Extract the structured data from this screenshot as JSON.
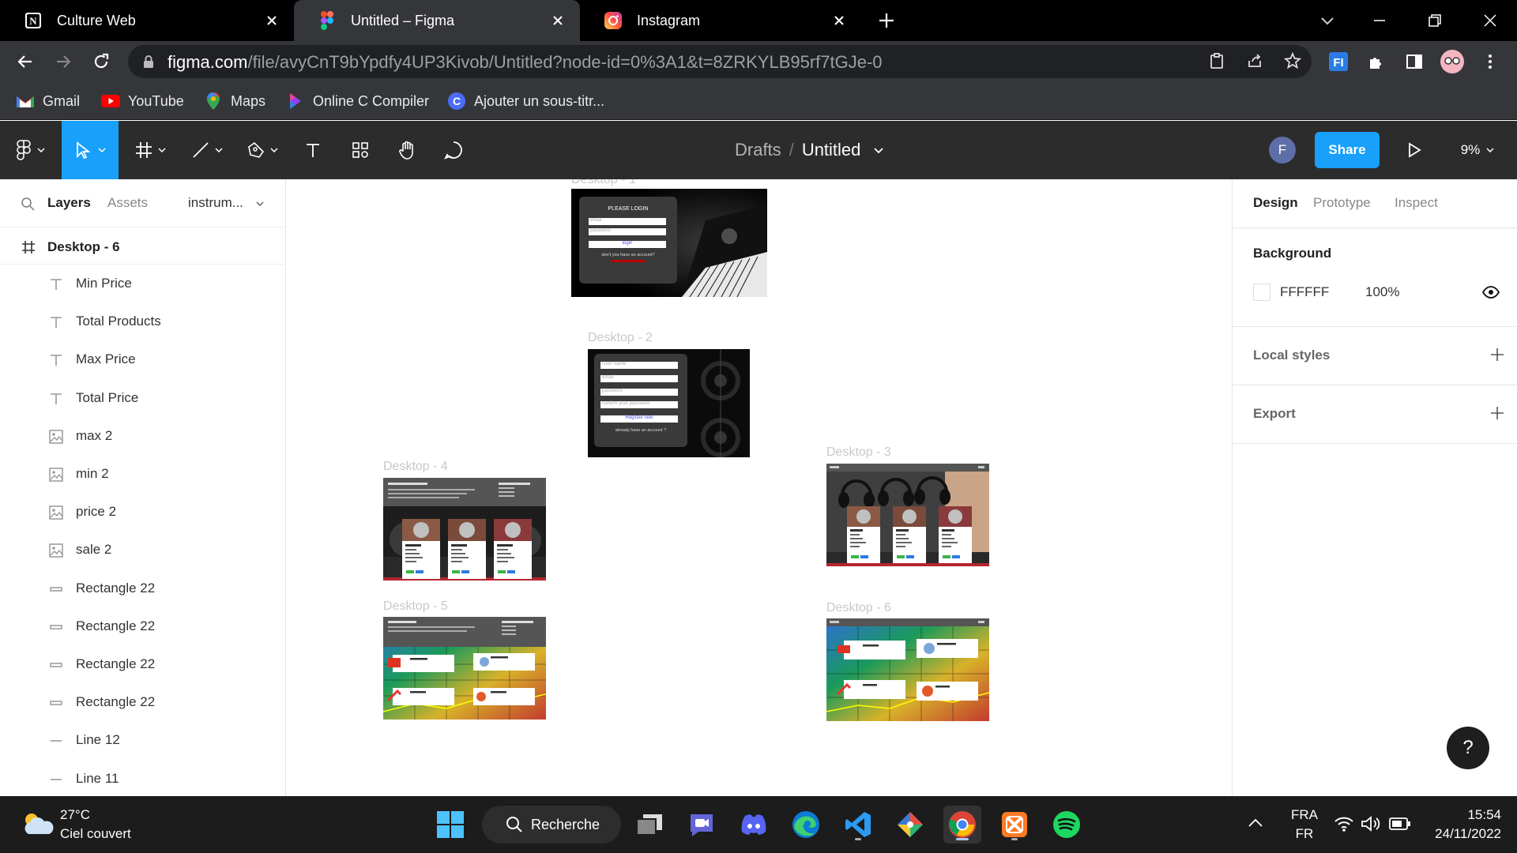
{
  "browser": {
    "tabs": [
      {
        "title": "Culture Web",
        "icon": "notion-icon"
      },
      {
        "title": "Untitled – Figma",
        "icon": "figma-icon"
      },
      {
        "title": "Instagram",
        "icon": "instagram-icon"
      }
    ],
    "url_domain": "figma.com",
    "url_path": "/file/avyCnT9bYpdfy4UP3Kivob/Untitled?node-id=0%3A1&t=8ZRKYLB95rf7tGJe-0",
    "bookmarks": [
      {
        "label": "Gmail",
        "icon": "gmail-icon"
      },
      {
        "label": "YouTube",
        "icon": "youtube-icon"
      },
      {
        "label": "Maps",
        "icon": "maps-icon"
      },
      {
        "label": "Online C Compiler",
        "icon": "compiler-icon"
      },
      {
        "label": "Ajouter un sous-titr...",
        "icon": "bookmark-c-icon"
      }
    ]
  },
  "figma": {
    "breadcrumb": {
      "parent": "Drafts",
      "file": "Untitled"
    },
    "share_label": "Share",
    "zoom": "9%",
    "user_initial": "F",
    "left_tabs": {
      "layers": "Layers",
      "assets": "Assets",
      "page": "instrum..."
    },
    "frame_root": "Desktop - 6",
    "layers": [
      {
        "name": "Min Price",
        "type": "text"
      },
      {
        "name": "Total Products",
        "type": "text"
      },
      {
        "name": "Max Price",
        "type": "text"
      },
      {
        "name": "Total Price",
        "type": "text"
      },
      {
        "name": "max 2",
        "type": "image"
      },
      {
        "name": "min 2",
        "type": "image"
      },
      {
        "name": "price 2",
        "type": "image"
      },
      {
        "name": "sale 2",
        "type": "image"
      },
      {
        "name": "Rectangle 22",
        "type": "rect"
      },
      {
        "name": "Rectangle 22",
        "type": "rect"
      },
      {
        "name": "Rectangle 22",
        "type": "rect"
      },
      {
        "name": "Rectangle 22",
        "type": "rect"
      },
      {
        "name": "Line 12",
        "type": "line"
      },
      {
        "name": "Line 11",
        "type": "line"
      }
    ],
    "right_tabs": {
      "design": "Design",
      "prototype": "Prototype",
      "inspect": "Inspect"
    },
    "background": {
      "heading": "Background",
      "hex": "FFFFFF",
      "opacity": "100%"
    },
    "local_styles": "Local styles",
    "export": "Export",
    "help": "?",
    "frames": {
      "d1": {
        "label": "Desktop - 1",
        "title": "PLEASE LOGIN",
        "email": "email",
        "password": "password",
        "button": "login",
        "footer": "don't you have an account?"
      },
      "d2": {
        "label": "Desktop - 2",
        "fields": [
          "User Name",
          "email",
          "password",
          "confirm your password"
        ],
        "button": "Register now",
        "footer": "already have an account ?"
      },
      "d3": {
        "label": "Desktop - 3"
      },
      "d4": {
        "label": "Desktop - 4"
      },
      "d5": {
        "label": "Desktop - 5"
      },
      "d6": {
        "label": "Desktop - 6"
      }
    }
  },
  "taskbar": {
    "weather_temp": "27°C",
    "weather_desc": "Ciel couvert",
    "search_label": "Recherche",
    "lang_top": "FRA",
    "lang_bottom": "FR",
    "time": "15:54",
    "date": "24/11/2022"
  },
  "colors": {
    "figma_blue": "#18a0fb",
    "figma_header": "#2c2c2c",
    "chrome_dark": "#35363a"
  }
}
